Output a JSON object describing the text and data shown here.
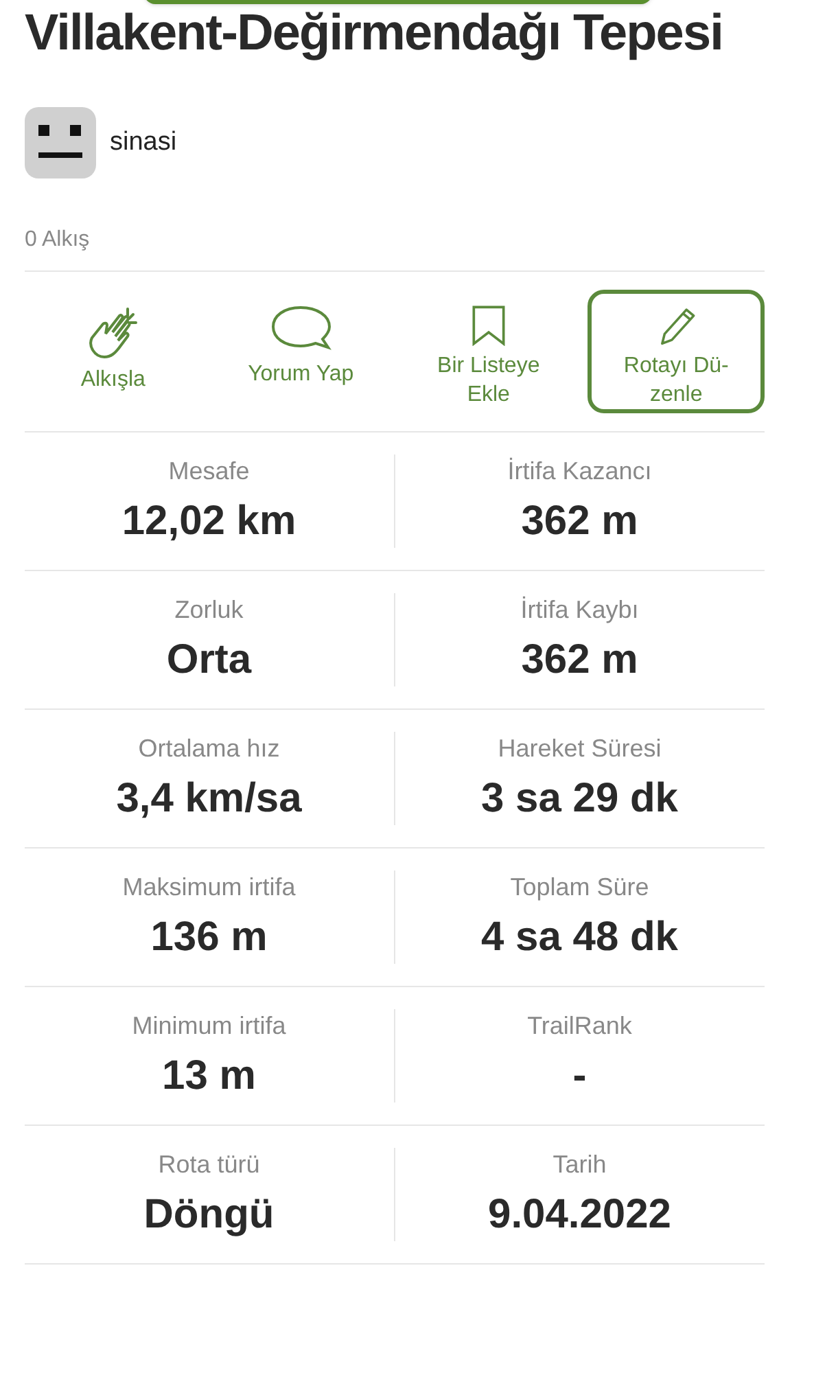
{
  "title": "Villakent-Değirmendağı Tepesi",
  "author": {
    "name": "sinasi"
  },
  "claps": "0 Alkış",
  "actions": [
    {
      "kind": "clap",
      "label": "Alkışla",
      "outlined": false
    },
    {
      "kind": "comment",
      "label": "Yorum Yap",
      "outlined": false
    },
    {
      "kind": "bookmark",
      "label": "Bir Listeye Ekle",
      "outlined": false
    },
    {
      "kind": "edit",
      "label": "Rotayı Dü-zenle",
      "outlined": true
    }
  ],
  "stats": [
    [
      {
        "label": "Mesafe",
        "value": "12,02 km"
      },
      {
        "label": "İrtifa Kazancı",
        "value": "362 m"
      }
    ],
    [
      {
        "label": "Zorluk",
        "value": "Orta"
      },
      {
        "label": "İrtifa Kaybı",
        "value": "362 m"
      }
    ],
    [
      {
        "label": "Ortalama hız",
        "value": "3,4 km/sa"
      },
      {
        "label": "Hareket Süresi",
        "value": "3 sa 29 dk"
      }
    ],
    [
      {
        "label": "Maksimum irtifa",
        "value": "136 m"
      },
      {
        "label": "Toplam Süre",
        "value": "4 sa 48 dk"
      }
    ],
    [
      {
        "label": "Minimum irtifa",
        "value": "13 m"
      },
      {
        "label": "TrailRank",
        "value": "-"
      }
    ],
    [
      {
        "label": "Rota türü",
        "value": "Döngü"
      },
      {
        "label": "Tarih",
        "value": "9.04.2022"
      }
    ]
  ]
}
